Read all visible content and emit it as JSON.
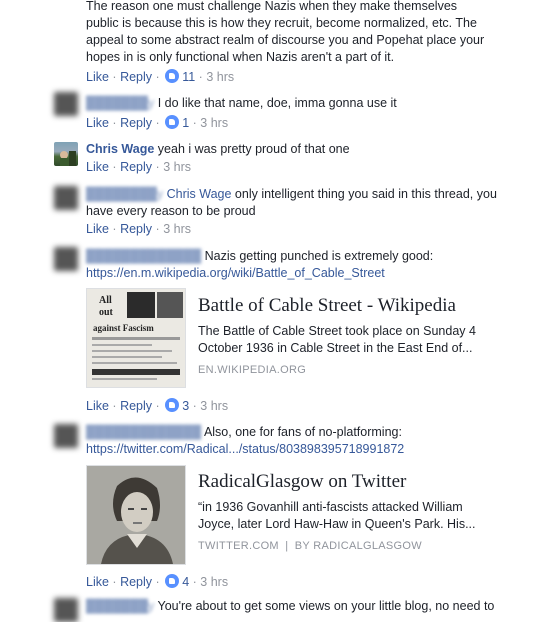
{
  "comments": [
    {
      "id": "c0",
      "author": "",
      "text": "The reason one must challenge Nazis when they make themselves public is because this is how they recruit, become normalized, etc. The appeal to some abstract realm of discourse you and Popehat place your hopes in is only functional when Nazis aren't a part of it.",
      "lines": [
        "The reason one must challenge Nazis when they make themselves",
        "public is because this is how they recruit, become normalized, etc. The",
        "appeal to some abstract realm of discourse you and Popehat place your",
        "hopes in is only functional when Nazis aren't a part of it."
      ],
      "likes": "11",
      "time": "3 hrs"
    },
    {
      "id": "c1",
      "author": "███████y",
      "text": "I do like that name, doe, imma gonna use it",
      "likes": "1",
      "time": "3 hrs"
    },
    {
      "id": "c2",
      "author": "Chris Wage",
      "text": "yeah i was pretty proud of that one",
      "time": "3 hrs"
    },
    {
      "id": "c3",
      "author": "████████y",
      "mention": "Chris Wage",
      "line1": "only intelligent thing you said in this thread, you",
      "line2": "have every reason to be proud",
      "time": "3 hrs"
    },
    {
      "id": "c4",
      "author": "█████████████",
      "text": "Nazis getting punched is extremely good:",
      "url": "https://en.m.wikipedia.org/wiki/Battle_of_Cable_Street",
      "card": {
        "title": "Battle of Cable Street - Wikipedia",
        "desc1": "The Battle of Cable Street took place on Sunday 4",
        "desc2": "October 1936 in Cable Street in the East End of...",
        "domain": "EN.WIKIPEDIA.ORG",
        "image_text": [
          "All",
          "out",
          "against Fascism"
        ]
      },
      "likes": "3",
      "time": "3 hrs"
    },
    {
      "id": "c5",
      "author": "█████████████",
      "text": "Also, one for fans of no-platforming:",
      "url": "https://twitter.com/Radical.../status/803898395718991872",
      "card": {
        "title": "RadicalGlasgow on Twitter",
        "desc1": "“in 1936 Govanhill anti-fascists attacked William",
        "desc2": "Joyce, later Lord Haw-Haw in Queen's Park. His...",
        "domain": "TWITTER.COM",
        "by": "BY RADICALGLASGOW"
      },
      "likes": "4",
      "time": "3 hrs"
    },
    {
      "id": "c6",
      "author": "███████y",
      "text": "You're about to get some views on your little blog, no need to"
    }
  ],
  "actions": {
    "like": "Like",
    "reply": "Reply",
    "dot": "·"
  },
  "colors": {
    "link": "#365899",
    "meta": "#90949c",
    "like_badge": "#5890ff"
  }
}
